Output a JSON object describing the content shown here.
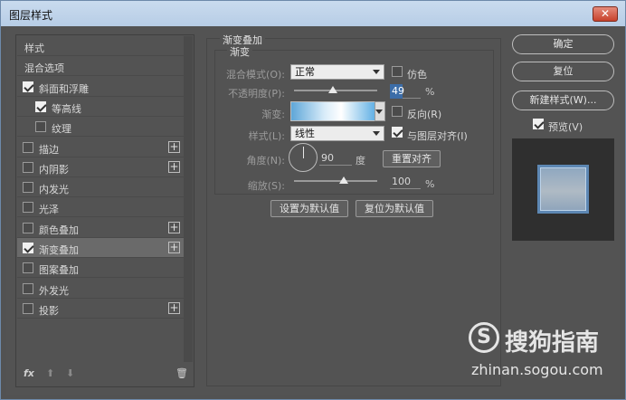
{
  "window": {
    "title": "图层样式",
    "close_label": "✕"
  },
  "left_panel": {
    "items": [
      {
        "label": "样式",
        "checkbox": false,
        "checked": false,
        "plus": false,
        "selected": false
      },
      {
        "label": "混合选项",
        "checkbox": false,
        "checked": false,
        "plus": false,
        "selected": false
      },
      {
        "label": "斜面和浮雕",
        "checkbox": true,
        "checked": true,
        "plus": false,
        "selected": false
      },
      {
        "label": "等高线",
        "checkbox": true,
        "checked": true,
        "plus": false,
        "selected": false
      },
      {
        "label": "纹理",
        "checkbox": true,
        "checked": false,
        "plus": false,
        "selected": false
      },
      {
        "label": "描边",
        "checkbox": true,
        "checked": false,
        "plus": true,
        "selected": false
      },
      {
        "label": "内阴影",
        "checkbox": true,
        "checked": false,
        "plus": true,
        "selected": false
      },
      {
        "label": "内发光",
        "checkbox": true,
        "checked": false,
        "plus": false,
        "selected": false
      },
      {
        "label": "光泽",
        "checkbox": true,
        "checked": false,
        "plus": false,
        "selected": false
      },
      {
        "label": "颜色叠加",
        "checkbox": true,
        "checked": false,
        "plus": true,
        "selected": false
      },
      {
        "label": "渐变叠加",
        "checkbox": true,
        "checked": true,
        "plus": true,
        "selected": true
      },
      {
        "label": "图案叠加",
        "checkbox": true,
        "checked": false,
        "plus": false,
        "selected": false
      },
      {
        "label": "外发光",
        "checkbox": true,
        "checked": false,
        "plus": false,
        "selected": false
      },
      {
        "label": "投影",
        "checkbox": true,
        "checked": false,
        "plus": true,
        "selected": false
      }
    ],
    "footer": {
      "fx": "fx",
      "up": "⬆",
      "down": "⬇",
      "trash": "🗑"
    }
  },
  "gradient_overlay": {
    "group_title": "渐变叠加",
    "sub_title": "渐变",
    "blend_mode_label": "混合模式(O):",
    "blend_mode_value": "正常",
    "dither_label": "仿色",
    "opacity_label": "不透明度(P):",
    "opacity_value": "49",
    "opacity_unit": "%",
    "gradient_label": "渐变:",
    "reverse_label": "反向(R)",
    "style_label": "样式(L):",
    "style_value": "线性",
    "align_label": "与图层对齐(I)",
    "angle_label": "角度(N):",
    "angle_value": "90",
    "angle_unit": "度",
    "reset_align_label": "重置对齐",
    "scale_label": "缩放(S):",
    "scale_value": "100",
    "scale_unit": "%",
    "set_default_label": "设置为默认值",
    "reset_default_label": "复位为默认值"
  },
  "right": {
    "ok_label": "确定",
    "reset_label": "复位",
    "new_style_label": "新建样式(W)...",
    "preview_label": "预览(V)"
  },
  "watermark": {
    "logo": "S",
    "text": "搜狗指南",
    "url": "zhinan.sogou.com"
  }
}
